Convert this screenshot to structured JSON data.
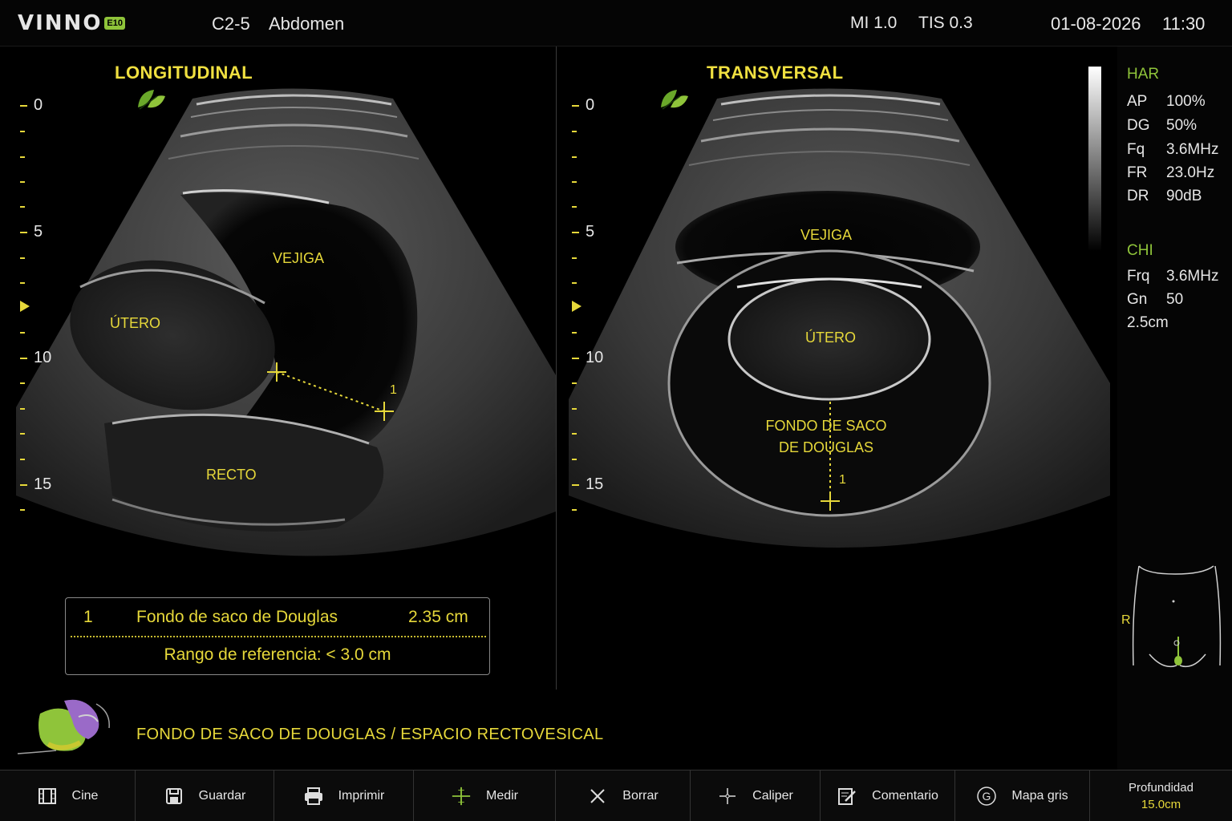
{
  "header": {
    "logo_text": "VINNO",
    "logo_badge": "E10",
    "probe": "C2-5",
    "preset": "Abdomen",
    "mi": "MI 1.0",
    "tis": "TIS 0.3",
    "date": "01-08-2026",
    "time": "11:30"
  },
  "left_view": {
    "title": "LONGITUDINAL",
    "scale": [
      "0",
      "5",
      "10",
      "15"
    ],
    "organs": {
      "bladder": "VEJIGA",
      "uterus": "ÚTERO",
      "rectum": "RECTO"
    },
    "measure_number": "1"
  },
  "right_view": {
    "title": "TRANSVERSAL",
    "scale": [
      "0",
      "5",
      "10",
      "15"
    ],
    "organs": {
      "bladder": "VEJIGA",
      "uterus": "ÚTERO",
      "pouch_line1": "FONDO DE SACO",
      "pouch_line2": "DE DOUGLAS"
    },
    "measure_number": "1"
  },
  "params": {
    "har_label": "HAR",
    "ap_label": "AP",
    "ap_value": "100%",
    "dg_label": "DG",
    "dg_value": "50%",
    "fq_label": "Fq",
    "fq_value": "3.6MHz",
    "fr_label": "FR",
    "fr_value": "23.0Hz",
    "dr_label": "DR",
    "dr_value": "90dB",
    "chi_label": "CHI",
    "frq_label": "Frq",
    "frq_value": "3.6MHz",
    "gn_label": "Gn",
    "gn_value": "50",
    "focus": "2.5cm"
  },
  "body_marker": {
    "side": "R"
  },
  "result": {
    "index": "1",
    "name": "Fondo de saco de Douglas",
    "value": "2.35 cm",
    "reference": "Rango de referencia: < 3.0 cm"
  },
  "annotation": "FONDO DE SACO DE DOUGLAS / ESPACIO RECTOVESICAL",
  "toolbar": {
    "cine": "Cine",
    "save": "Guardar",
    "print": "Imprimir",
    "measure": "Medir",
    "delete": "Borrar",
    "caliper": "Caliper",
    "comment": "Comentario",
    "graymap": "Mapa gris",
    "depth_label": "Profundidad",
    "depth_value": "15.0cm"
  },
  "colors": {
    "accent_yellow": "#e6d83a",
    "accent_green": "#8fc43a",
    "background": "#000000"
  }
}
